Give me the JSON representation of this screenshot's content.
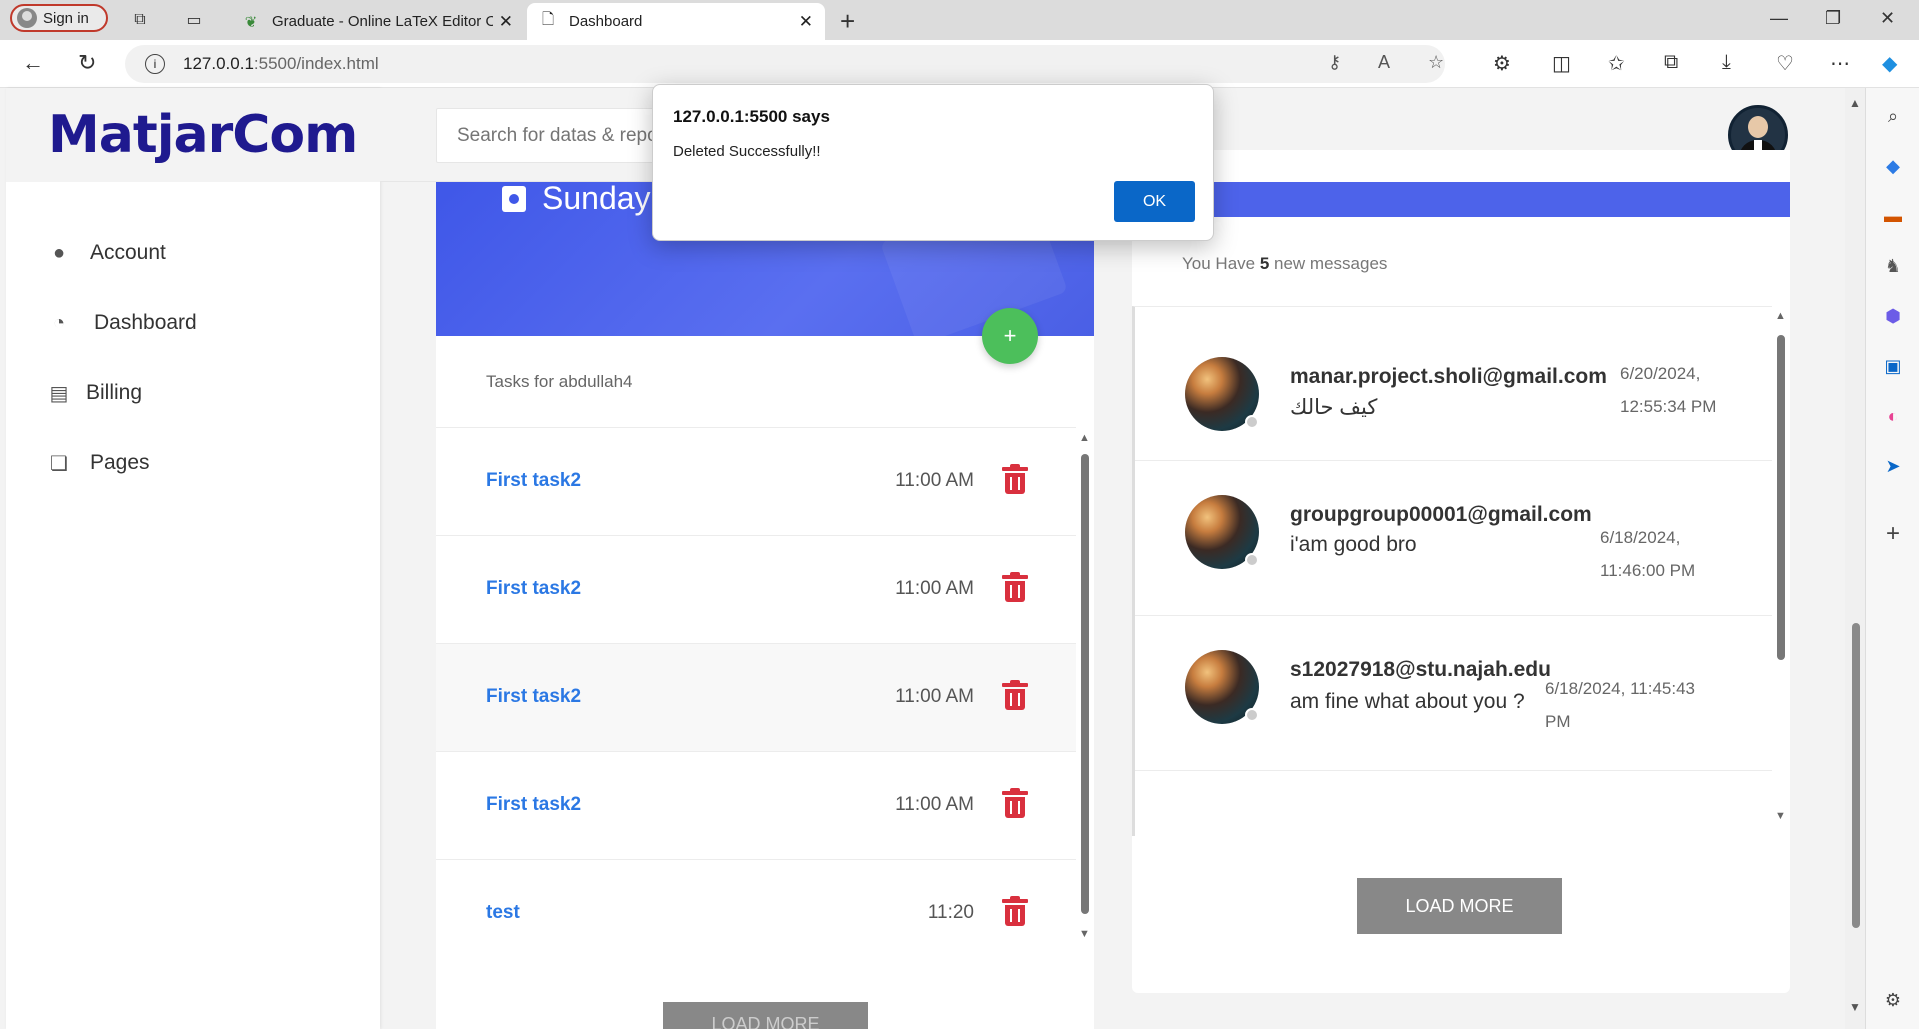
{
  "browser": {
    "signin_label": "Sign in",
    "tabs": [
      {
        "label": "Graduate - Online LaTeX Editor O"
      },
      {
        "label": "Dashboard"
      }
    ],
    "url_host": "127.0.0.1",
    "url_path": ":5500/index.html"
  },
  "sidebar": {
    "logo": "MatjarCom",
    "items": [
      {
        "label": "Account"
      },
      {
        "label": "Dashboard"
      },
      {
        "label": "Billing"
      },
      {
        "label": "Pages"
      }
    ]
  },
  "header": {
    "search_placeholder": "Search for datas & reports"
  },
  "tasks": {
    "banner_title": "Sunday",
    "add_label": "+",
    "subtitle": "Tasks for abdullah4",
    "items": [
      {
        "title": "First task2",
        "time": "11:00 AM"
      },
      {
        "title": "First task2",
        "time": "11:00 AM"
      },
      {
        "title": "First task2",
        "time": "11:00 AM"
      },
      {
        "title": "First task2",
        "time": "11:00 AM"
      },
      {
        "title": "test",
        "time": "11:20"
      }
    ],
    "load_more": "LOAD MORE"
  },
  "messages": {
    "subtitle_pre": "You Have ",
    "count": "5",
    "subtitle_post": " new messages",
    "items": [
      {
        "from": "manar.project.sholi@gmail.com",
        "text": "كيف حالك",
        "date": "6/20/2024, 12:55:34 PM"
      },
      {
        "from": "groupgroup00001@gmail.com",
        "text": "i'am good bro",
        "date": "6/18/2024, 11:46:00 PM"
      },
      {
        "from": "s12027918@stu.najah.edu",
        "text": "am fine what about you ?",
        "date": "6/18/2024, 11:45:43 PM"
      }
    ],
    "load_more": "LOAD MORE"
  },
  "dialog": {
    "title": "127.0.0.1:5500 says",
    "message": "Deleted Successfully!!",
    "ok": "OK"
  },
  "colors": {
    "brand": "#1f1a8f",
    "banner": "#3f57e8",
    "task_link": "#2b78e4",
    "delete": "#d9303e",
    "fab": "#4cbf5b",
    "dialog_ok": "#0a67c8"
  }
}
